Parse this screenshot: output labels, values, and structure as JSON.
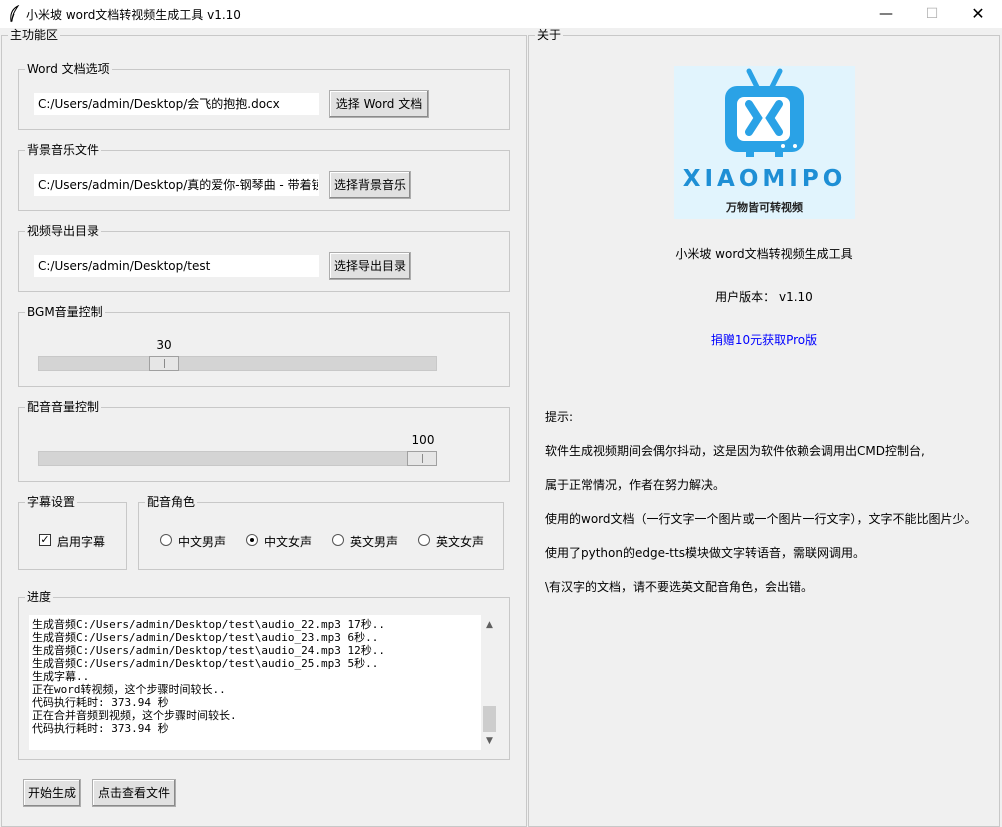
{
  "window": {
    "title": "小米坡 word文档转视频生成工具 v1.10",
    "minimize": "—",
    "maximize": "☐",
    "close": "✕"
  },
  "main_panel": {
    "title": "主功能区",
    "word": {
      "group_label": "Word 文档选项",
      "value": "C:/Users/admin/Desktop/会飞的抱抱.docx",
      "button": "选择 Word 文档"
    },
    "music": {
      "group_label": "背景音乐文件",
      "value": "C:/Users/admin/Desktop/真的爱你-钢琴曲 - 带着镜",
      "button": "选择背景音乐"
    },
    "output": {
      "group_label": "视频导出目录",
      "value": "C:/Users/admin/Desktop/test",
      "button": "选择导出目录"
    },
    "bgm_volume": {
      "group_label": "BGM音量控制",
      "value": 30,
      "max": 100
    },
    "voice_volume": {
      "group_label": "配音音量控制",
      "value": 100,
      "max": 100
    },
    "subtitle": {
      "group_label": "字幕设置",
      "checkbox_label": "启用字幕",
      "checked": true
    },
    "voice_role": {
      "group_label": "配音角色",
      "options": [
        "中文男声",
        "中文女声",
        "英文男声",
        "英文女声"
      ],
      "selected": "中文女声"
    },
    "progress": {
      "group_label": "进度",
      "log": "生成音频C:/Users/admin/Desktop/test\\audio_22.mp3 17秒..\n生成音频C:/Users/admin/Desktop/test\\audio_23.mp3 6秒..\n生成音频C:/Users/admin/Desktop/test\\audio_24.mp3 12秒..\n生成音频C:/Users/admin/Desktop/test\\audio_25.mp3 5秒..\n生成字幕..\n正在word转视频，这个步骤时间较长..\n代码执行耗时: 373.94 秒\n正在合并音频到视频，这个步骤时间较长.\n代码执行耗时: 373.94 秒"
    },
    "start_button": "开始生成",
    "view_button": "点击查看文件"
  },
  "about_panel": {
    "title": "关于",
    "logo_brand": "XIAOMIPO",
    "logo_slogan": "万物皆可转视频",
    "app_name": "小米坡 word文档转视频生成工具",
    "version": "用户版本： v1.10",
    "donate_link": "捐赠10元获取Pro版",
    "tips": [
      "提示:",
      "软件生成视频期间会偶尔抖动，这是因为软件依赖会调用出CMD控制台,",
      "属于正常情况，作者在努力解决。",
      "使用的word文档（一行文字一个图片或一个图片一行文字），文字不能比图片少。",
      "使用了python的edge-tts模块做文字转语音，需联网调用。",
      "\\有汉字的文档，请不要选英文配音角色，会出错。"
    ]
  },
  "colors": {
    "link": "#0000ff",
    "logo_blue": "#2aa2e6",
    "logo_bg": "#e1f4fd"
  }
}
